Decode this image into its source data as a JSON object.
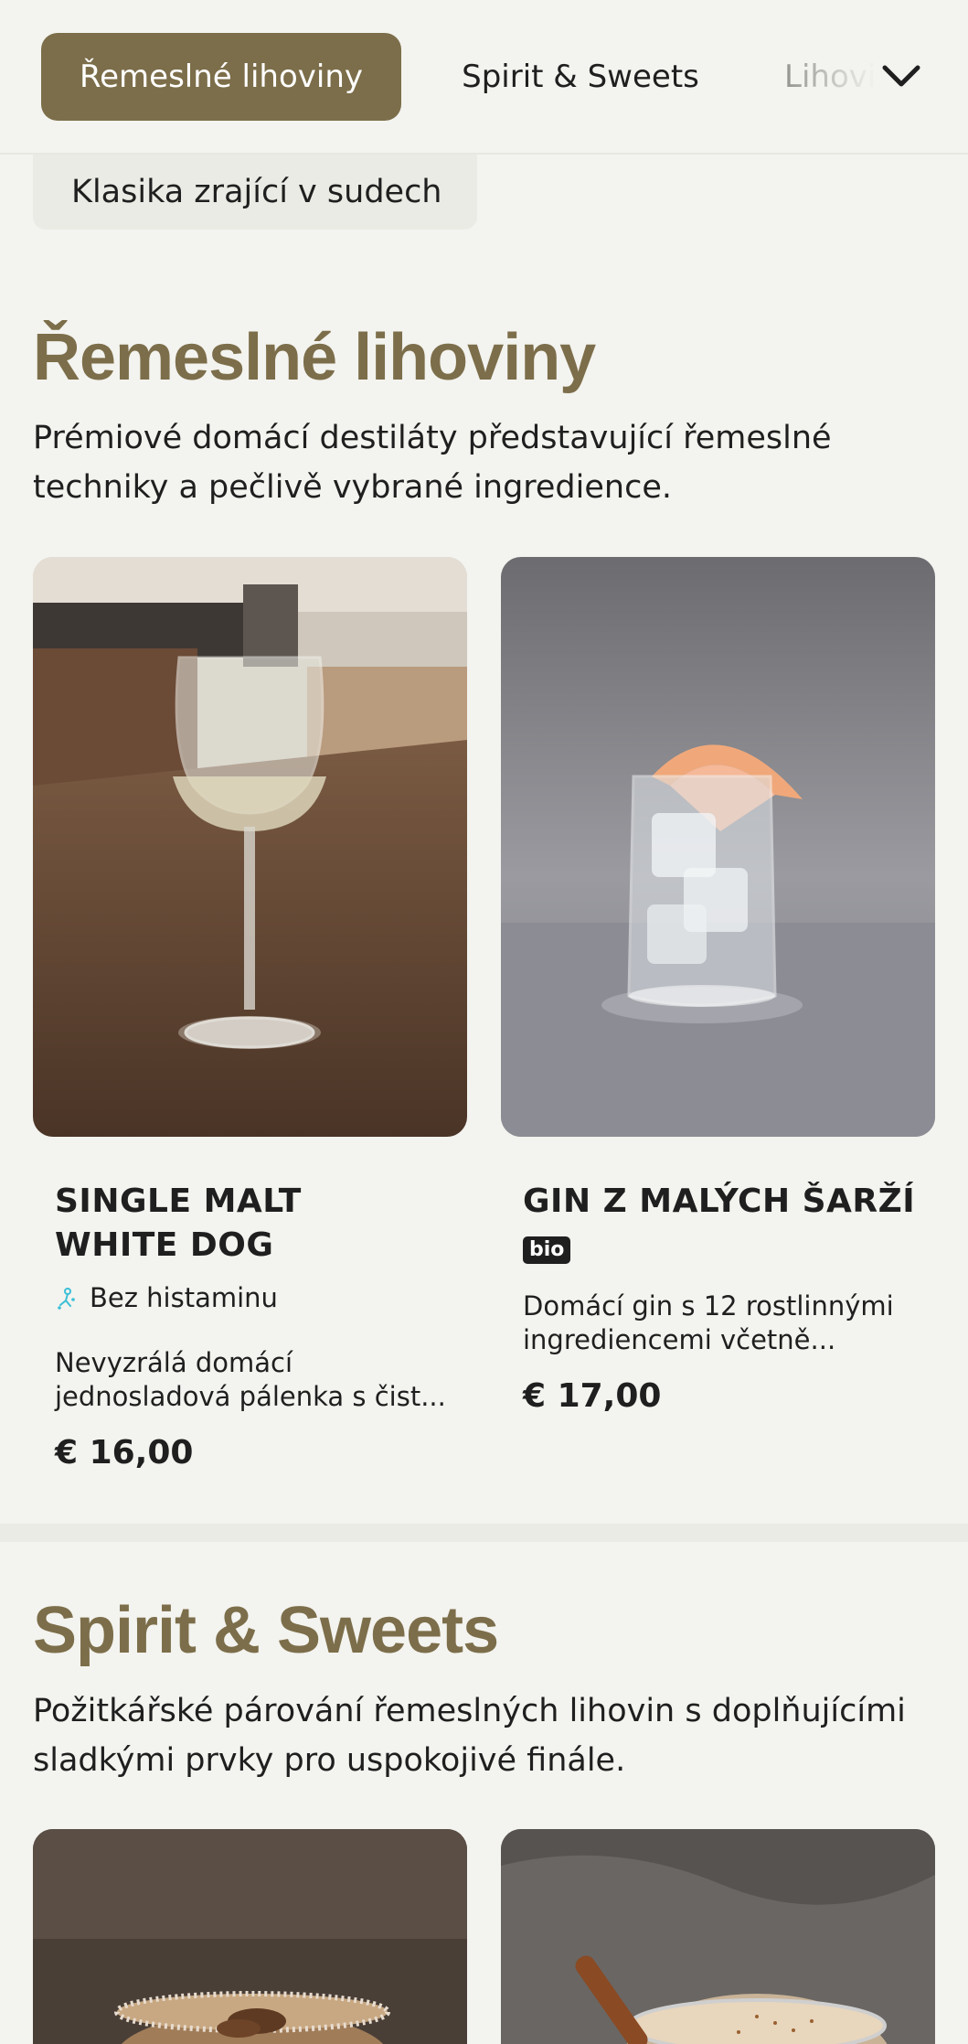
{
  "nav": {
    "categories": [
      {
        "label": "Řemeslné lihoviny",
        "active": true
      },
      {
        "label": "Spirit & Sweets",
        "active": false
      },
      {
        "label": "Lihoviny",
        "active": false
      }
    ],
    "expand_icon": "chevron-down-icon",
    "subcategory": "Klasika zrající v sudech"
  },
  "sections": [
    {
      "title": "Řemeslné lihoviny",
      "description": "Prémiové domácí destiláty představující řemeslné techniky a pečlivě vybrané ingredience.",
      "products": [
        {
          "name": "SINGLE MALT WHITE DOG",
          "allergen": "Bez histaminu",
          "allergen_icon": "histamine-free-icon",
          "description": "Nevyzrálá domácí jednosladová pálenka s čist...",
          "price": "€ 16,00",
          "image": "wine-glass-on-table"
        },
        {
          "name": "GIN Z MALÝCH ŠARŽÍ",
          "badge": "bio",
          "description": "Domácí gin s 12 rostlinnými ingrediencemi včetně...",
          "price": "€ 17,00",
          "image": "gin-tonic-with-grapefruit"
        }
      ]
    },
    {
      "title": "Spirit & Sweets",
      "description": "Požitkářské párování řemeslných lihovin s doplňujícími sladkými prvky pro uspokojivé finále.",
      "products": [
        {
          "image": "dessert-cocktail-with-pecans"
        },
        {
          "image": "cinnamon-cream-drink"
        }
      ]
    }
  ],
  "colors": {
    "accent": "#7c6e4a",
    "background": "#f3f3ef",
    "text": "#1f1f1f",
    "allergen_icon": "#3bbfd6"
  }
}
